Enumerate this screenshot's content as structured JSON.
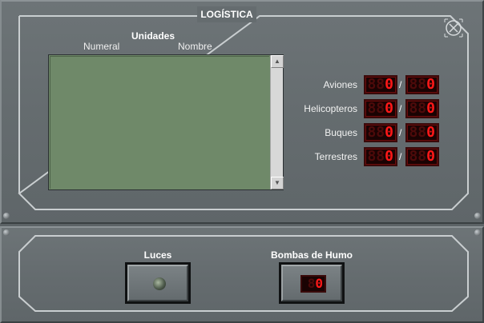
{
  "window": {
    "title": "LOGÍSTICA"
  },
  "units": {
    "title": "Unidades",
    "columns": [
      "Numeral",
      "Nombre"
    ],
    "rows": []
  },
  "stats": [
    {
      "label": "Aviones",
      "dim_a": "88",
      "value_a": "0",
      "dim_b": "88",
      "value_b": "0"
    },
    {
      "label": "Helicopteros",
      "dim_a": "88",
      "value_a": "0",
      "dim_b": "88",
      "value_b": "0"
    },
    {
      "label": "Buques",
      "dim_a": "88",
      "value_a": "0",
      "dim_b": "88",
      "value_b": "0"
    },
    {
      "label": "Terrestres",
      "dim_a": "88",
      "value_a": "0",
      "dim_b": "88",
      "value_b": "0"
    }
  ],
  "separator": "/",
  "lights": {
    "label": "Luces",
    "state": "off"
  },
  "smoke": {
    "label": "Bombas de Humo",
    "dim": "8",
    "value": "0"
  },
  "icons": {
    "close": "close-x-icon",
    "scroll_up": "arrow-up-icon",
    "scroll_down": "arrow-down-icon",
    "lamp": "indicator-lamp-icon"
  },
  "colors": {
    "panel": "#656c6f",
    "list_bg": "#6f8969",
    "led_on": "#ff1818",
    "led_off": "#4d0a0a"
  }
}
